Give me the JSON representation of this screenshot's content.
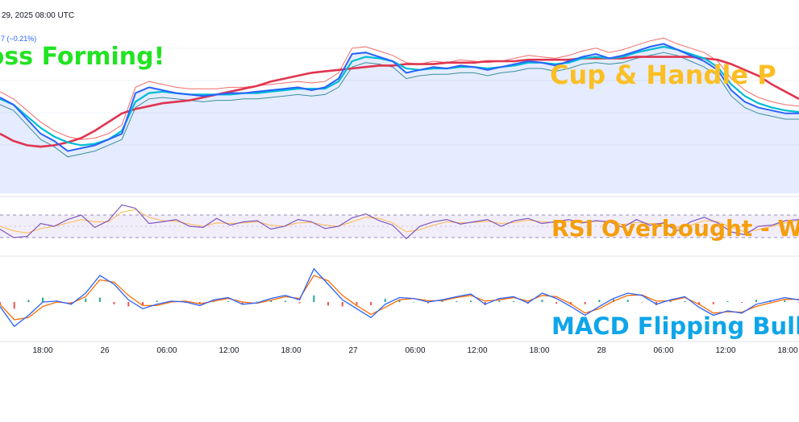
{
  "header": {
    "timestamp": "29, 2025 08:00 UTC",
    "change": "7 (−0.21%)"
  },
  "annotations": {
    "golden_cross": "ross Forming!",
    "cup_handle": "Cup & Handle P",
    "rsi": "RSI Overbought - W",
    "macd": "MACD Flipping Bull"
  },
  "colors": {
    "price": "#2962ff",
    "fast_ma": "#00bcd4",
    "slow_ma": "#e0344f",
    "band": "#f06b6b",
    "rsi": "#7e57c2",
    "rsi_signal": "#ffb74d",
    "macd": "#2962ff",
    "macd_signal": "#ff6d00",
    "hist_up": "#26a69a",
    "hist_down": "#ef5350"
  },
  "chart_data": [
    {
      "type": "line",
      "panel": "price",
      "x_ticks": [
        "18:00",
        "26",
        "06:00",
        "12:00",
        "18:00",
        "27",
        "06:00",
        "12:00",
        "18:00",
        "28",
        "06:00",
        "12:00",
        "18:00"
      ],
      "ylim": [
        0,
        100
      ],
      "series": [
        {
          "role": "price",
          "values": [
            55,
            50,
            40,
            30,
            25,
            18,
            20,
            22,
            26,
            30,
            58,
            62,
            60,
            58,
            57,
            56,
            57,
            58,
            58,
            59,
            60,
            61,
            62,
            60,
            62,
            68,
            85,
            86,
            83,
            80,
            72,
            74,
            76,
            75,
            77,
            76,
            74,
            76,
            78,
            80,
            79,
            77,
            80,
            83,
            85,
            82,
            84,
            87,
            90,
            92,
            88,
            84,
            80,
            74,
            60,
            52,
            48,
            46,
            44,
            44
          ]
        },
        {
          "role": "fast-ma",
          "values": [
            54,
            50,
            42,
            34,
            28,
            24,
            22,
            23,
            26,
            32,
            52,
            58,
            59,
            58,
            57,
            57,
            57,
            57,
            58,
            58,
            59,
            60,
            61,
            61,
            61,
            66,
            80,
            83,
            82,
            80,
            75,
            74,
            75,
            75,
            76,
            76,
            75,
            76,
            77,
            79,
            79,
            78,
            79,
            82,
            83,
            82,
            83,
            86,
            88,
            90,
            88,
            85,
            82,
            76,
            64,
            56,
            51,
            48,
            46,
            45
          ]
        },
        {
          "role": "slow-ma",
          "values": [
            30,
            25,
            22,
            21,
            22,
            24,
            27,
            32,
            38,
            44,
            47,
            49,
            51,
            52,
            53,
            55,
            57,
            59,
            61,
            63,
            66,
            68,
            70,
            72,
            73,
            74,
            75,
            76,
            77,
            77,
            78,
            78,
            78,
            79,
            79,
            79,
            80,
            80,
            80,
            81,
            81,
            81,
            81,
            82,
            82,
            82,
            82,
            83,
            83,
            83,
            83,
            83,
            82,
            81,
            78,
            74,
            70,
            64,
            59,
            54
          ]
        }
      ]
    },
    {
      "type": "line",
      "panel": "rsi",
      "ylim": [
        0,
        100
      ],
      "bands": [
        30,
        70
      ],
      "series": [
        {
          "role": "rsi",
          "values": [
            45,
            30,
            32,
            55,
            50,
            62,
            70,
            48,
            60,
            88,
            82,
            55,
            58,
            62,
            50,
            48,
            64,
            52,
            58,
            60,
            45,
            50,
            62,
            58,
            46,
            50,
            65,
            72,
            60,
            52,
            28,
            50,
            58,
            62,
            54,
            58,
            62,
            50,
            60,
            64,
            55,
            58,
            62,
            56,
            60,
            58,
            48,
            62,
            52,
            56,
            42,
            58,
            66,
            56,
            40,
            35,
            50,
            52,
            60,
            62
          ]
        },
        {
          "role": "rsi-signal",
          "values": [
            50,
            42,
            38,
            46,
            50,
            56,
            62,
            58,
            58,
            75,
            80,
            66,
            60,
            59,
            54,
            50,
            56,
            55,
            56,
            58,
            52,
            50,
            56,
            57,
            52,
            50,
            58,
            66,
            64,
            56,
            40,
            44,
            52,
            58,
            56,
            57,
            59,
            55,
            57,
            61,
            58,
            57,
            59,
            58,
            59,
            58,
            53,
            57,
            55,
            55,
            48,
            52,
            60,
            58,
            48,
            40,
            44,
            50,
            56,
            60
          ]
        }
      ]
    },
    {
      "type": "line",
      "panel": "macd",
      "ylim": [
        -100,
        100
      ],
      "series": [
        {
          "role": "macd",
          "values": [
            -10,
            -55,
            -30,
            0,
            2,
            -5,
            20,
            60,
            40,
            5,
            -15,
            -5,
            2,
            0,
            -8,
            5,
            10,
            -5,
            -2,
            8,
            15,
            5,
            75,
            40,
            5,
            -15,
            -35,
            -5,
            10,
            8,
            0,
            5,
            12,
            18,
            -5,
            8,
            12,
            -2,
            20,
            8,
            -10,
            -30,
            -10,
            8,
            20,
            15,
            -5,
            5,
            12,
            -12,
            -30,
            -20,
            -25,
            -5,
            2,
            10,
            5
          ]
        },
        {
          "role": "macd-signal",
          "values": [
            -5,
            -40,
            -35,
            -10,
            0,
            -3,
            12,
            50,
            45,
            15,
            -8,
            -8,
            0,
            2,
            -4,
            2,
            8,
            0,
            -3,
            4,
            12,
            8,
            60,
            48,
            15,
            -8,
            -28,
            -12,
            5,
            8,
            3,
            3,
            10,
            15,
            2,
            5,
            10,
            2,
            15,
            12,
            -4,
            -25,
            -15,
            2,
            15,
            16,
            2,
            3,
            10,
            -5,
            -25,
            -22,
            -23,
            -10,
            -2,
            6,
            6
          ]
        }
      ],
      "histogram": [
        -5,
        -15,
        5,
        10,
        2,
        -2,
        8,
        10,
        -5,
        -10,
        -7,
        3,
        2,
        -2,
        -4,
        3,
        2,
        -5,
        1,
        4,
        3,
        -3,
        15,
        -8,
        -10,
        -7,
        -7,
        7,
        5,
        0,
        -3,
        2,
        2,
        3,
        -7,
        3,
        2,
        -4,
        5,
        -4,
        -6,
        -5,
        5,
        6,
        5,
        -1,
        -7,
        2,
        2,
        -7,
        -5,
        2,
        -2,
        5,
        4,
        4,
        -1
      ]
    }
  ]
}
